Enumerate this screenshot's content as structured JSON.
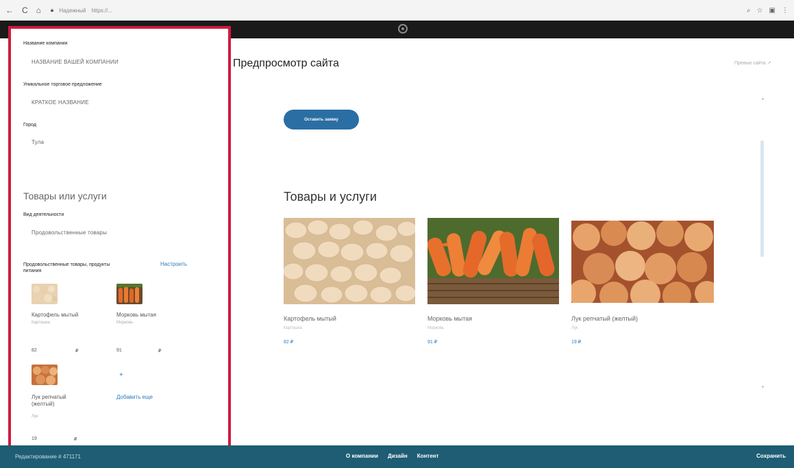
{
  "browser": {
    "secure_label": "Надежный",
    "url": "https://..."
  },
  "left_panel": {
    "company_label": "Название компании",
    "company_value": "НАЗВАНИЕ ВАШЕЙ КОМПАНИИ",
    "usp_label": "Уникальное торговое предложение",
    "usp_value": "КРАТКОЕ НАЗВАНИЕ",
    "city_label": "Город",
    "city_value": "Тула",
    "section_title": "Товары или услуги",
    "activity_label": "Вид деятельности",
    "activity_value": "Продовольственные товары",
    "category_label": "Продовольственные товары, продукты питания",
    "configure_link": "Настроить",
    "items": [
      {
        "name": "Картофель мытый",
        "sub": "Картошка",
        "price": "82",
        "currency": "₽"
      },
      {
        "name": "Морковь мытая",
        "sub": "Морковь",
        "price": "91",
        "currency": "₽"
      },
      {
        "name": "Лук репчатый (желтый)",
        "sub": "Лук",
        "price": "19",
        "currency": "₽"
      }
    ],
    "add_plus": "+",
    "add_more": "Добавить еще"
  },
  "preview": {
    "title": "Предпросмотр сайта",
    "open_link": "Превью сайта ↗",
    "cta_label": "Оставить заявку",
    "products_title": "Товары и услуги",
    "cards": [
      {
        "name": "Картофель мытый",
        "sub": "Картошка",
        "price": "82 ₽"
      },
      {
        "name": "Морковь мытая",
        "sub": "Морковь",
        "price": "91 ₽"
      },
      {
        "name": "Лук репчатый (желтый)",
        "sub": "Лук",
        "price": "19 ₽"
      }
    ]
  },
  "bottom_bar": {
    "edit_label": "Редактирование # 471171",
    "tabs": [
      "О компании",
      "Дизайн",
      "Контент"
    ],
    "save_label": "Сохранить"
  },
  "colors": {
    "accent": "#2b6ea4",
    "highlight_border": "#cf1b3f",
    "bottom_bar": "#1e5d74",
    "link": "#2b7bc0"
  }
}
